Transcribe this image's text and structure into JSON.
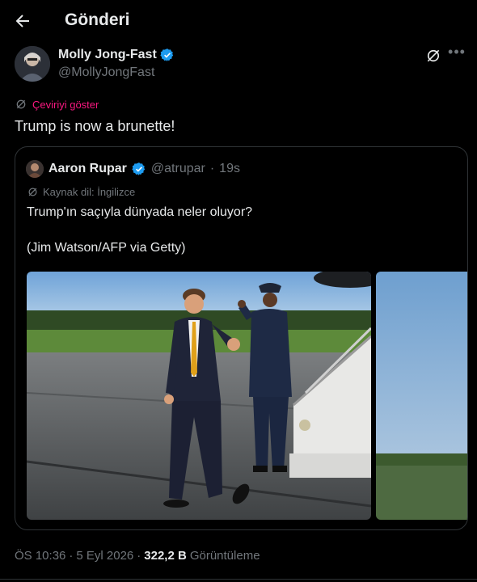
{
  "header": {
    "title": "Gönderi"
  },
  "post": {
    "author_name": "Molly Jong-Fast",
    "author_handle": "@MollyJongFast",
    "translate_label": "Çeviriyi göster",
    "text": "Trump is now a brunette!"
  },
  "quote": {
    "author_name": "Aaron Rupar",
    "author_handle": "@atrupar",
    "separator": "·",
    "time": "19s",
    "source_lang": "Kaynak dil: İngilizce",
    "text_line1": "Trump'ın saçıyla dünyada neler oluyor?",
    "text_line2": "(Jim Watson/AFP via Getty)"
  },
  "footer": {
    "time": "ÖS 10:36",
    "sep": "·",
    "date": "5 Eyl 2026",
    "sep2": "·",
    "views_count": "322,2 B",
    "views_label": "Görüntüleme"
  },
  "colors": {
    "accent": "#1d9bf0",
    "pink": "#f91880",
    "text": "#e7e9ea",
    "muted": "#71767b"
  },
  "icons": [
    "back-arrow-icon",
    "verified-badge-icon",
    "grok-icon",
    "more-icon",
    "translate-icon"
  ]
}
